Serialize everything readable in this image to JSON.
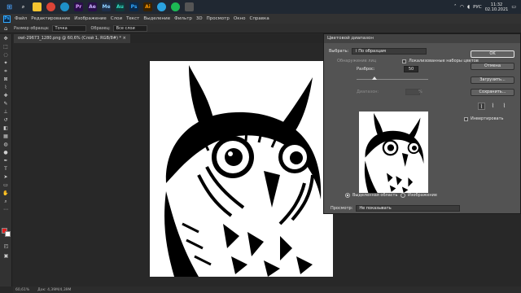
{
  "taskbar": {
    "apps": [
      {
        "icon": "file-explorer-icon",
        "color": "#f4c430",
        "label": ""
      },
      {
        "icon": "chrome-icon",
        "color": "#db4437",
        "label": ""
      },
      {
        "icon": "edge-icon",
        "color": "#1e90c8",
        "label": ""
      },
      {
        "icon": "premiere-icon",
        "color": "#2a0f4a",
        "label": "Pr"
      },
      {
        "icon": "after-effects-icon",
        "color": "#2a0f4a",
        "label": "Ae"
      },
      {
        "icon": "media-encoder-icon",
        "color": "#1e2f4a",
        "label": "Me"
      },
      {
        "icon": "audition-icon",
        "color": "#0f3a3a",
        "label": "Au"
      },
      {
        "icon": "photoshop-icon",
        "color": "#0b2a4a",
        "label": "Ps"
      },
      {
        "icon": "illustrator-icon",
        "color": "#3a2200",
        "label": "Ai"
      },
      {
        "icon": "telegram-icon",
        "color": "#2aa3e0",
        "label": ""
      },
      {
        "icon": "spotify-icon",
        "color": "#1db954",
        "label": ""
      },
      {
        "icon": "app-icon",
        "color": "#555555",
        "label": ""
      }
    ],
    "lang": "РУС",
    "time": "11:32",
    "date": "02.10.2021"
  },
  "menubar": {
    "logo": "Ps",
    "items": [
      "Файл",
      "Редактирование",
      "Изображение",
      "Слои",
      "Текст",
      "Выделение",
      "Фильтр",
      "3D",
      "Просмотр",
      "Окно",
      "Справка"
    ]
  },
  "optbar": {
    "sample_size_label": "Размер образца:",
    "sample_size_value": "Точка",
    "sample_label": "Образец:",
    "sample_value": "Все слои"
  },
  "document": {
    "tab_title": "owl-29673_1280.png @ 60,6% (Слой 1, RGB/8#) * ×"
  },
  "statusbar": {
    "zoom": "60,61%",
    "doc_size": "Док: 4,39M/4,39M"
  },
  "dialog": {
    "title": "Цветовой диапазон",
    "select_label": "Выбрать:",
    "select_value": "По образцам",
    "localized_label": "Обнаружение лиц",
    "localized_clusters_label": "Локализованные наборы цветов",
    "fuzziness_label": "Разброс:",
    "fuzziness_value": "50",
    "fuzziness_fraction": 0.25,
    "range_label": "Диапазон:",
    "range_value": "%",
    "radio_selection": "Выделенная область",
    "radio_image": "Изображение",
    "preview_label": "Просмотр:",
    "preview_value": "Не показывать",
    "ok_label": "OK",
    "cancel_label": "Отмена",
    "load_label": "Загрузить...",
    "save_label": "Сохранить...",
    "invert_label": "Инвертировать",
    "accent": "#e6e6e6"
  },
  "colors": {
    "foreground": "#e02020",
    "background": "#ffffff"
  }
}
